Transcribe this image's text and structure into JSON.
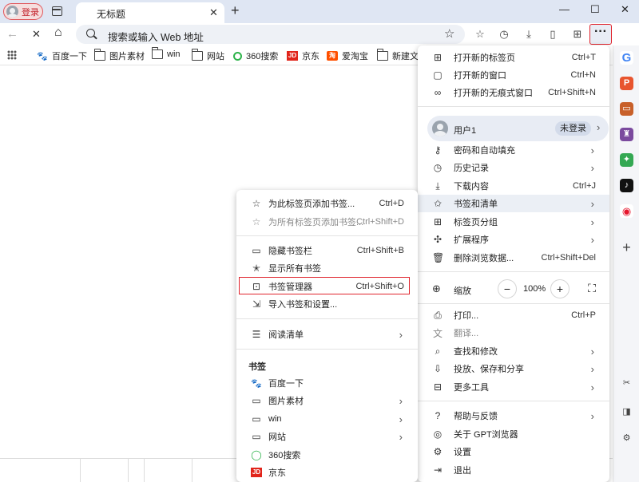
{
  "tabstrip": {
    "profile_label": "登录",
    "tab_title": "无标题",
    "close_glyph": "✕",
    "newtab_glyph": "+",
    "minimize_glyph": "—",
    "maximize_glyph": "☐",
    "window_close_glyph": "✕"
  },
  "toolbar": {
    "back_glyph": "←",
    "stop_glyph": "✕",
    "home_glyph": "⌂",
    "omnibox_placeholder": "搜索或输入 Web 地址",
    "more_glyph": "···"
  },
  "bookmarks_bar": [
    {
      "label": "百度一下",
      "icon": "baidu-paw-icon"
    },
    {
      "label": "图片素材",
      "icon": "folder-icon"
    },
    {
      "label": "win",
      "icon": "folder-icon"
    },
    {
      "label": "网站",
      "icon": "folder-icon"
    },
    {
      "label": "360搜索",
      "icon": "360-icon"
    },
    {
      "label": "京东",
      "icon": "jd-icon"
    },
    {
      "label": "爱淘宝",
      "icon": "taobao-icon"
    },
    {
      "label": "新建文件",
      "icon": "folder-icon"
    }
  ],
  "main_menu": {
    "group1": [
      {
        "label": "打开新的标签页",
        "shortcut": "Ctrl+T",
        "icon": "new-tab-icon"
      },
      {
        "label": "打开新的窗口",
        "shortcut": "Ctrl+N",
        "icon": "new-window-icon"
      },
      {
        "label": "打开新的无痕式窗口",
        "shortcut": "Ctrl+Shift+N",
        "icon": "incognito-icon"
      }
    ],
    "user": {
      "name": "用户1",
      "status": "未登录"
    },
    "group2": [
      {
        "label": "密码和自动填充",
        "icon": "key-icon"
      },
      {
        "label": "历史记录",
        "icon": "history-icon"
      },
      {
        "label": "下载内容",
        "shortcut": "Ctrl+J",
        "icon": "download-icon"
      },
      {
        "label": "书签和清单",
        "icon": "bookmark-star-icon"
      },
      {
        "label": "标签页分组",
        "icon": "tab-group-icon"
      },
      {
        "label": "扩展程序",
        "icon": "puzzle-icon"
      },
      {
        "label": "删除浏览数据...",
        "shortcut": "Ctrl+Shift+Del",
        "icon": "trash-icon"
      }
    ],
    "zoom": {
      "label": "缩放",
      "value": "100%",
      "minus": "−",
      "plus": "+",
      "fullscreen": "⛶"
    },
    "group3": [
      {
        "label": "打印...",
        "shortcut": "Ctrl+P",
        "icon": "print-icon"
      },
      {
        "label": "翻译...",
        "icon": "translate-icon"
      },
      {
        "label": "查找和修改",
        "icon": "find-icon"
      },
      {
        "label": "投放、保存和分享",
        "icon": "cast-icon"
      },
      {
        "label": "更多工具",
        "icon": "toolbox-icon"
      }
    ],
    "group4": [
      {
        "label": "帮助与反馈",
        "icon": "help-icon"
      },
      {
        "label": "关于 GPT浏览器",
        "icon": "about-icon"
      },
      {
        "label": "设置",
        "icon": "settings-icon"
      },
      {
        "label": "退出",
        "icon": "exit-icon"
      }
    ]
  },
  "bookmark_menu": {
    "group1": [
      {
        "label": "为此标签页添加书签...",
        "shortcut": "Ctrl+D"
      },
      {
        "label": "为所有标签页添加书签...",
        "shortcut": "Ctrl+Shift+D"
      }
    ],
    "group2": [
      {
        "label": "隐藏书签栏",
        "shortcut": "Ctrl+Shift+B"
      },
      {
        "label": "显示所有书签"
      },
      {
        "label": "书签管理器",
        "shortcut": "Ctrl+Shift+O"
      },
      {
        "label": "导入书签和设置..."
      }
    ],
    "reading_list": "阅读清单",
    "section_title": "书签",
    "bookmarks": [
      {
        "label": "百度一下"
      },
      {
        "label": "图片素材"
      },
      {
        "label": "win"
      },
      {
        "label": "网站"
      },
      {
        "label": "360搜索"
      },
      {
        "label": "京东"
      }
    ]
  },
  "sidebar_icons": [
    "google-icon",
    "office-icon",
    "toolbox-icon",
    "game-icon",
    "apps-icon",
    "tiktok-icon",
    "weibo-icon",
    "add-icon",
    "screenshot-icon",
    "sidebar-toggle-icon",
    "settings-icon"
  ],
  "colors": {
    "highlight_red": "#e0242d",
    "tabstrip_bg": "#dfe6f3"
  }
}
